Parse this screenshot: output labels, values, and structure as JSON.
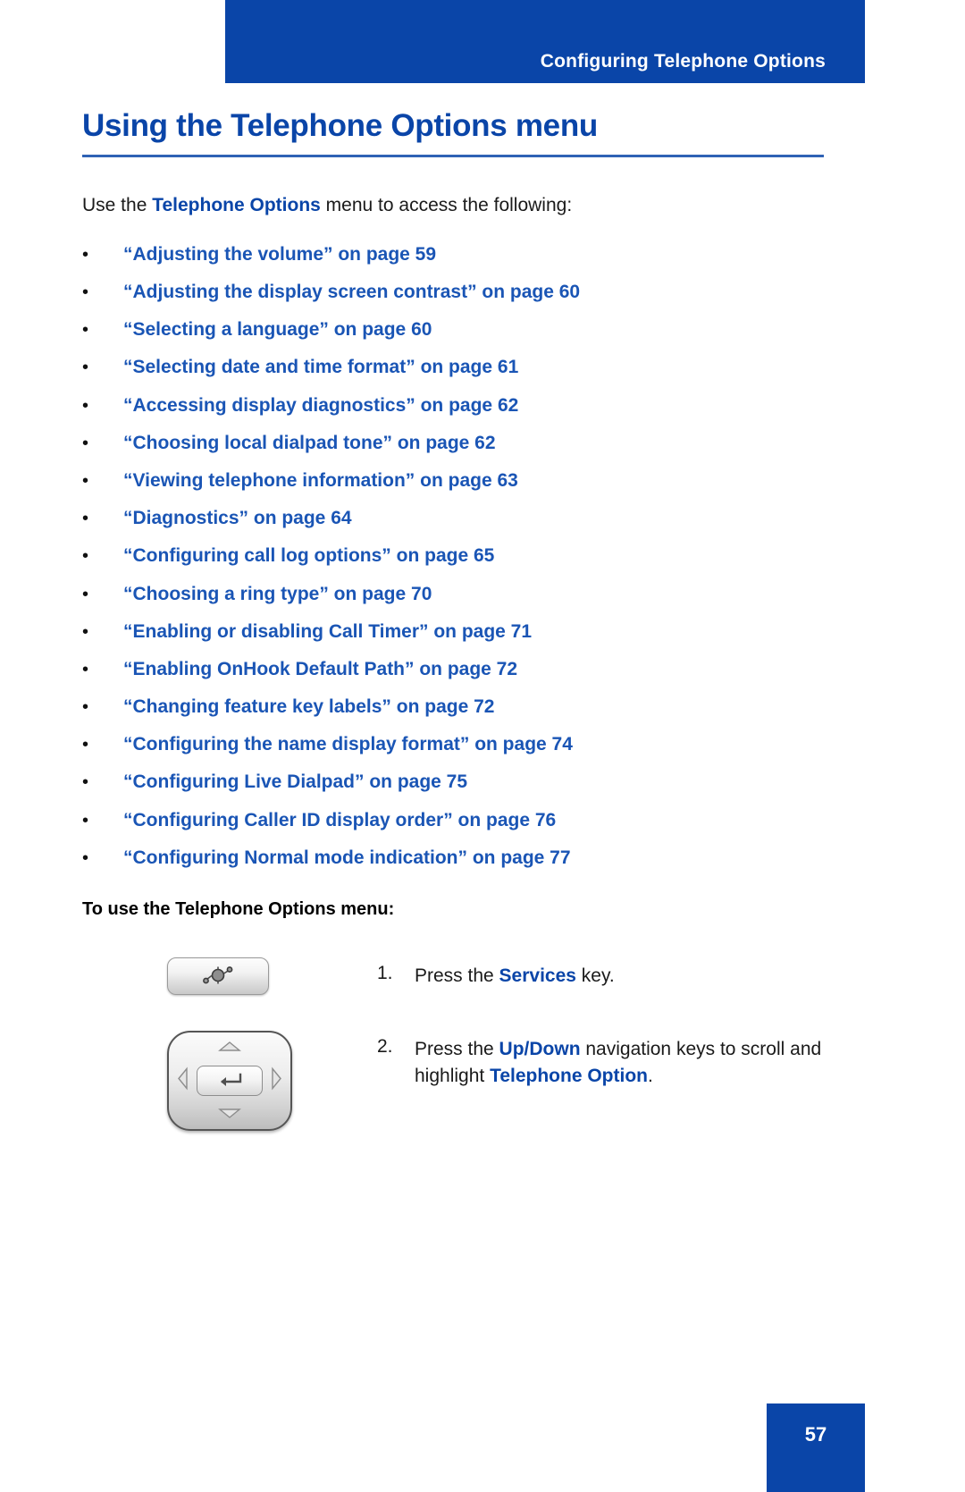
{
  "header": {
    "running_title": "Configuring Telephone Options",
    "bar_color": "#0a45a8"
  },
  "title": "Using the Telephone Options menu",
  "intro": {
    "before": "Use the ",
    "emphasis": "Telephone Options",
    "after": " menu to access the following:"
  },
  "bullet_marker": "•",
  "cross_references": [
    "“Adjusting the volume” on page 59",
    "“Adjusting the display screen contrast” on page 60",
    "“Selecting a language” on page 60",
    "“Selecting date and time format” on page 61",
    "“Accessing display diagnostics” on page 62",
    "“Choosing local dialpad tone” on page 62",
    "“Viewing telephone information” on page 63",
    "“Diagnostics” on page 64",
    "“Configuring call log options” on page 65",
    "“Choosing a ring type” on page 70",
    "“Enabling or disabling Call Timer” on page 71",
    "“Enabling OnHook Default Path” on page 72",
    "“Changing feature key labels” on page 72",
    "“Configuring the name display format” on page 74",
    "“Configuring Live Dialpad” on page 75",
    "“Configuring Caller ID display order” on page 76",
    "“Configuring Normal mode indication” on page 77"
  ],
  "procedure_heading": "To use the Telephone Options menu:",
  "steps": [
    {
      "number": "1.",
      "figure": "services-key",
      "text_before": "Press the ",
      "emphasis": "Services",
      "text_after": " key."
    },
    {
      "number": "2.",
      "figure": "navigation-cluster",
      "text_before": "Press the ",
      "emphasis": "Up/Down",
      "text_middle": " navigation keys to scroll and highlight ",
      "emphasis2": "Telephone Option",
      "text_after": "."
    }
  ],
  "footer": {
    "page_number": "57",
    "box_color": "#0a45a8"
  },
  "colors": {
    "brand_blue": "#0a45a8",
    "link_blue": "#1a55b5",
    "body_text": "#1a1a1a",
    "page_background": "#ffffff"
  }
}
